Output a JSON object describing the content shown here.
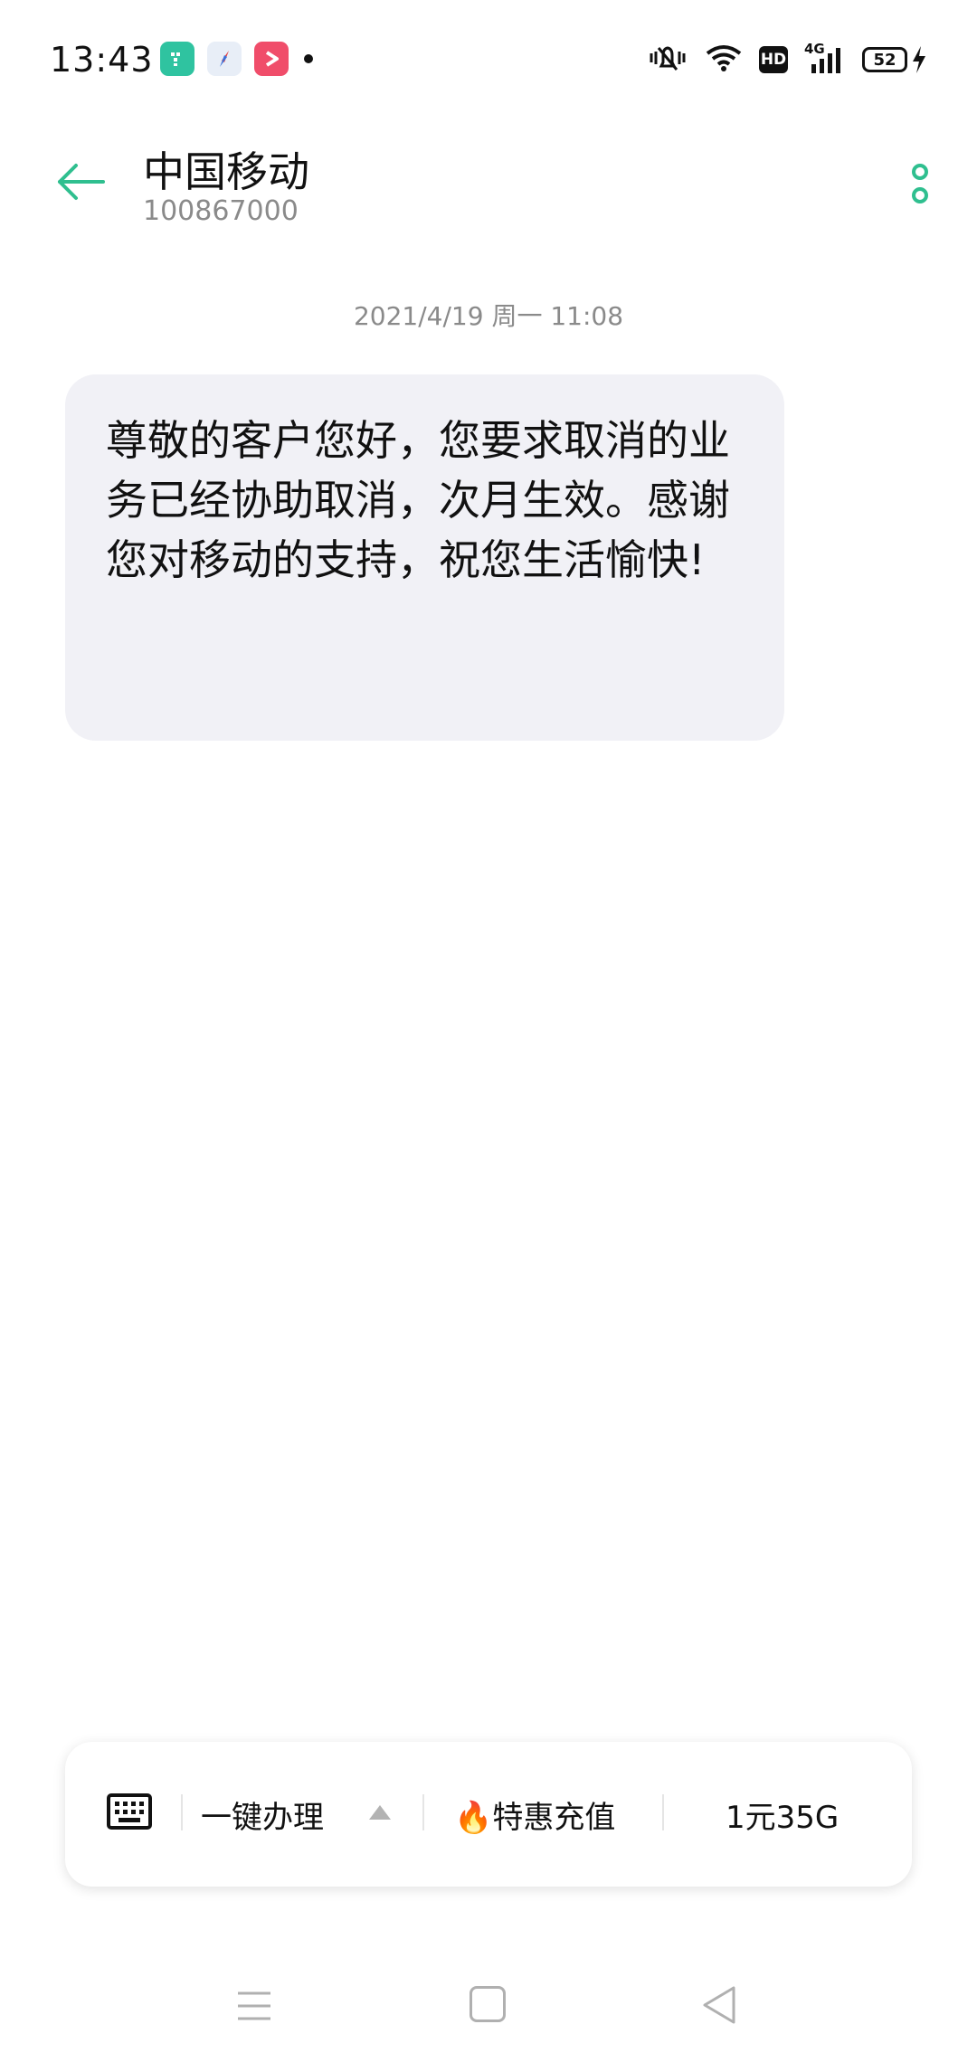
{
  "status_bar": {
    "time": "13:43",
    "battery": "52",
    "hd_label": "HD",
    "network_label": "4G",
    "notification_icons": [
      "app-icon-green",
      "compass-icon",
      "video-icon"
    ]
  },
  "header": {
    "title": "中国移动",
    "number": "100867000"
  },
  "message": {
    "timestamp": "2021/4/19 周一 11:08",
    "text": "尊敬的客户您好，您要求取消的业务已经协助取消，次月生效。感谢您对移动的支持，祝您生活愉快!"
  },
  "quick_actions": {
    "item1": "一键办理",
    "item2": "🔥特惠充值",
    "item3": "1元35G"
  },
  "colors": {
    "accent": "#2fbf8f",
    "bubble": "#f1f1f6",
    "muted_text": "#8a8a8a"
  }
}
